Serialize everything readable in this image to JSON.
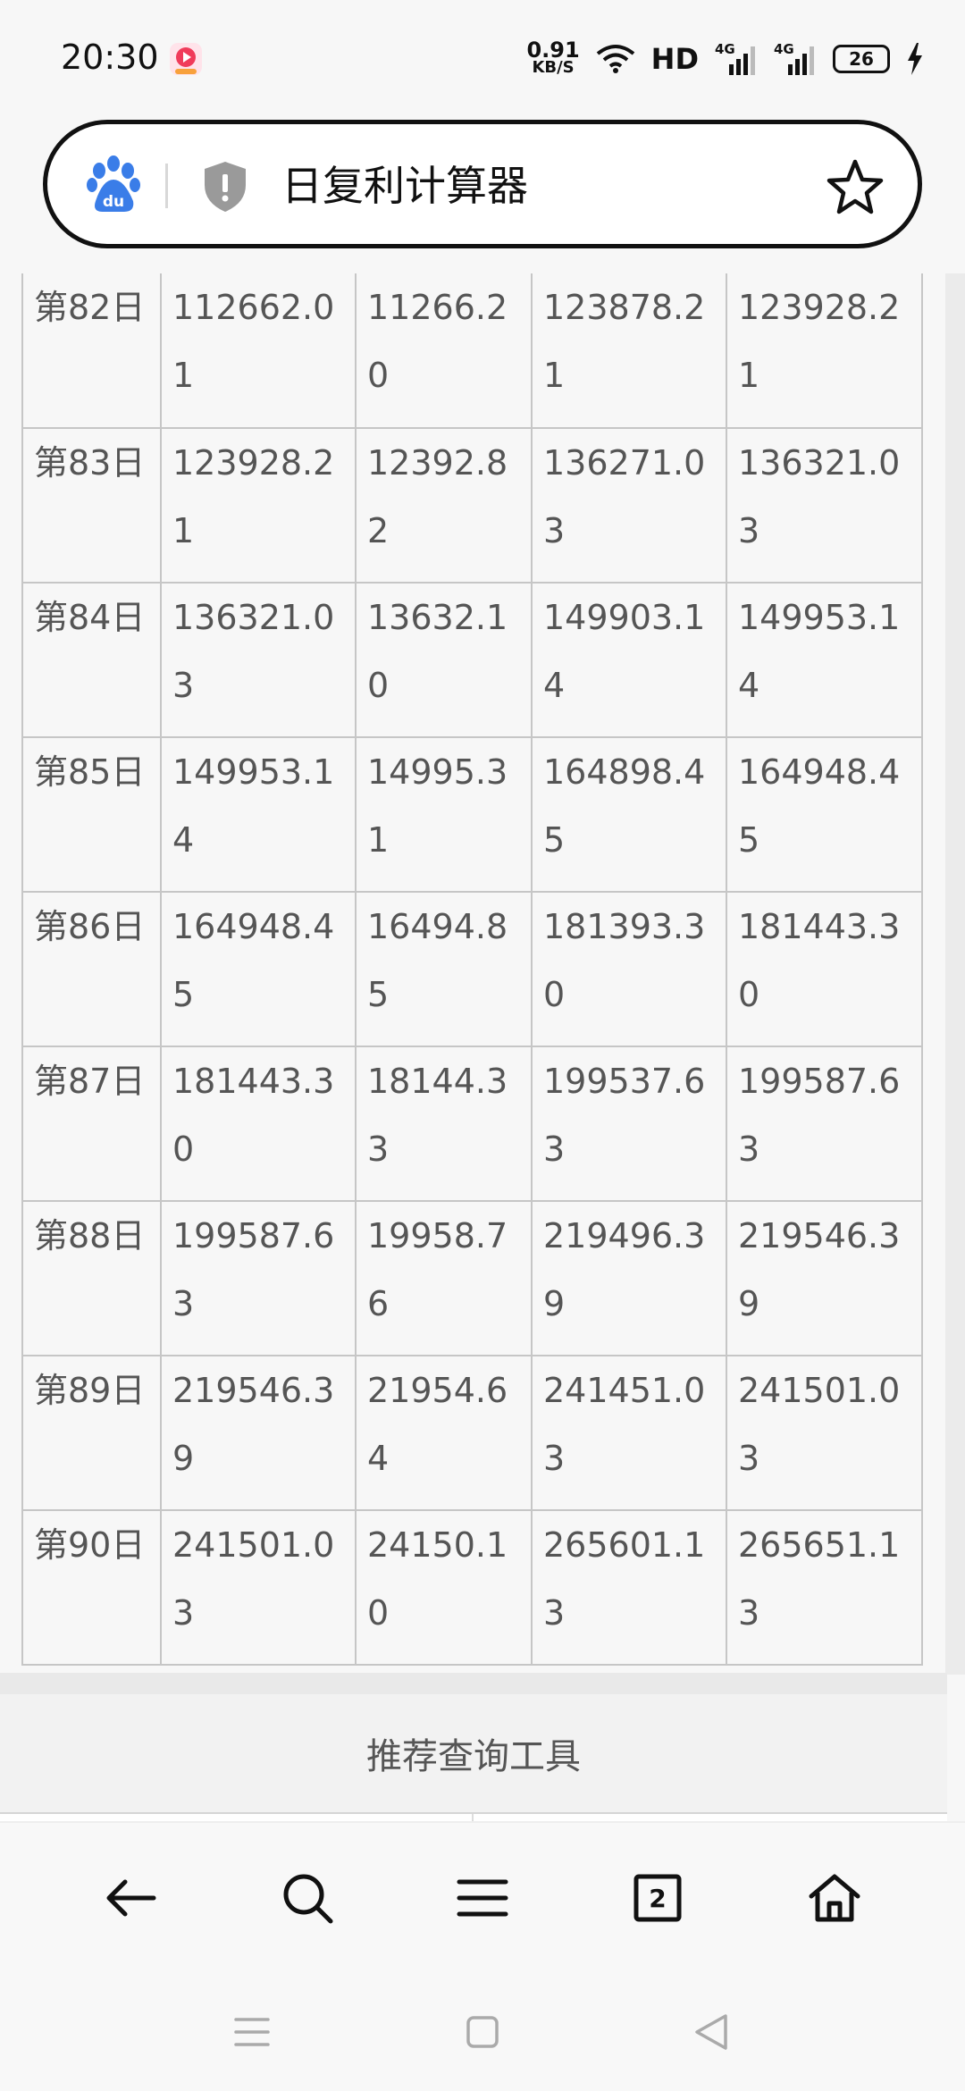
{
  "status_bar": {
    "time": "20:30",
    "net_speed_value": "0.91",
    "net_speed_unit": "KB/S",
    "hd_label": "HD",
    "signal1_label": "4G",
    "signal2_label": "4G",
    "battery_level": "26"
  },
  "address_bar": {
    "title": "日复利计算器"
  },
  "table": {
    "rows": [
      [
        "第82日",
        "112662.01",
        "11266.20",
        "123878.21",
        "123928.21"
      ],
      [
        "第83日",
        "123928.21",
        "12392.82",
        "136271.03",
        "136321.03"
      ],
      [
        "第84日",
        "136321.03",
        "13632.10",
        "149903.14",
        "149953.14"
      ],
      [
        "第85日",
        "149953.14",
        "14995.31",
        "164898.45",
        "164948.45"
      ],
      [
        "第86日",
        "164948.45",
        "16494.85",
        "181393.30",
        "181443.30"
      ],
      [
        "第87日",
        "181443.30",
        "18144.33",
        "199537.63",
        "199587.63"
      ],
      [
        "第88日",
        "199587.63",
        "19958.76",
        "219496.39",
        "219546.39"
      ],
      [
        "第89日",
        "219546.39",
        "21954.64",
        "241451.03",
        "241501.03"
      ],
      [
        "第90日",
        "241501.03",
        "24150.10",
        "265601.13",
        "265651.13"
      ]
    ]
  },
  "recommend": {
    "title": "推荐查询工具"
  },
  "toolbar": {
    "tabs_count": "2"
  }
}
